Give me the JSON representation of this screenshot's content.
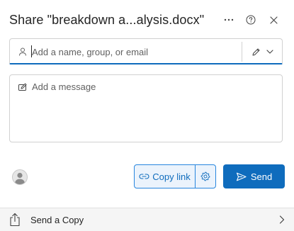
{
  "dialog": {
    "title": "Share \"breakdown a...alysis.docx\""
  },
  "header": {
    "more_icon": "ellipsis-icon",
    "help_icon": "question-circle-icon",
    "close_icon": "close-icon"
  },
  "recipients": {
    "placeholder": "Add a name, group, or email",
    "value": "",
    "permission_icon": "pencil-icon"
  },
  "message": {
    "placeholder": "Add a message",
    "value": ""
  },
  "actions": {
    "copy_link_label": "Copy link",
    "send_label": "Send"
  },
  "footer": {
    "send_copy_label": "Send a Copy"
  },
  "colors": {
    "accent": "#0f6cbd",
    "copy_link_border": "#2886de",
    "copy_link_bg": "#ebf3fc"
  }
}
